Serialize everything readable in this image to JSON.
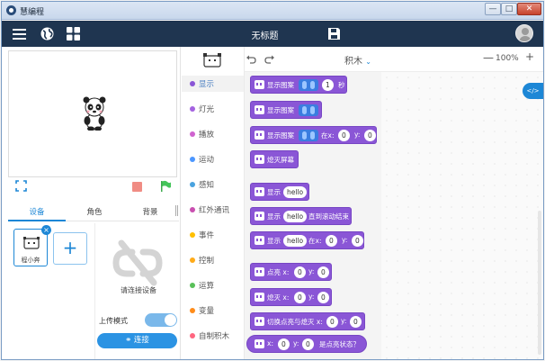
{
  "window": {
    "title": "慧编程",
    "minimize": "—",
    "maximize": "□",
    "close": "✕"
  },
  "topbar": {
    "title": "无标题",
    "menu_icon": "menu-icon",
    "globe_icon": "globe-icon",
    "grid_icon": "grid-icon",
    "save_icon": "save-icon"
  },
  "stage": {
    "sprite": "panda"
  },
  "tabs": [
    {
      "label": "设备"
    },
    {
      "label": "角色"
    },
    {
      "label": "背景"
    }
  ],
  "device": {
    "name": "程小奔",
    "add": "+"
  },
  "connect": {
    "hint": "请连接设备",
    "upload_label": "上传模式",
    "upload_mode_on": true,
    "button": "连接"
  },
  "categories": [
    {
      "label": "显示",
      "color": "#8a56d6"
    },
    {
      "label": "灯光",
      "color": "#a463e0"
    },
    {
      "label": "播放",
      "color": "#cf63cf"
    },
    {
      "label": "运动",
      "color": "#4c97ff"
    },
    {
      "label": "感知",
      "color": "#4aa3df"
    },
    {
      "label": "红外通讯",
      "color": "#c94fb0"
    },
    {
      "label": "事件",
      "color": "#ffbf00"
    },
    {
      "label": "控制",
      "color": "#ffab19"
    },
    {
      "label": "运算",
      "color": "#59c059"
    },
    {
      "label": "变量",
      "color": "#ff8c1a"
    },
    {
      "label": "自制积木",
      "color": "#ff6680"
    }
  ],
  "toolbar": {
    "dropdown": "积木",
    "zoom_out": "—",
    "zoom_level": "100%",
    "zoom_in": "+",
    "code_toggle": "</>"
  },
  "blocks": {
    "b1": {
      "text": "显示图案",
      "val": "1",
      "unit": "秒"
    },
    "b2": {
      "text": "显示图案"
    },
    "b3": {
      "text": "显示图案",
      "at_x": "在x:",
      "x": "0",
      "y_label": "y:",
      "y": "0"
    },
    "b4": {
      "text": "熄灭屏幕"
    },
    "b5": {
      "text": "显示",
      "val": "hello"
    },
    "b6": {
      "text": "显示",
      "val": "hello",
      "tail": "直到滚动结束"
    },
    "b7": {
      "text": "显示",
      "val": "hello",
      "at_x": "在x:",
      "x": "0",
      "y_label": "y:",
      "y": "0"
    },
    "b8": {
      "text": "点亮 x:",
      "x": "0",
      "y_label": "y:",
      "y": "0"
    },
    "b9": {
      "text": "熄灭 x:",
      "x": "0",
      "y_label": "y:",
      "y": "0"
    },
    "b10": {
      "text": "切换点亮与熄灭 x:",
      "x": "0",
      "y_label": "y:",
      "y": "0"
    },
    "b11": {
      "text": "x:",
      "x": "0",
      "y_label": "y:",
      "y": "0",
      "tail": "是点亮状态？"
    }
  }
}
